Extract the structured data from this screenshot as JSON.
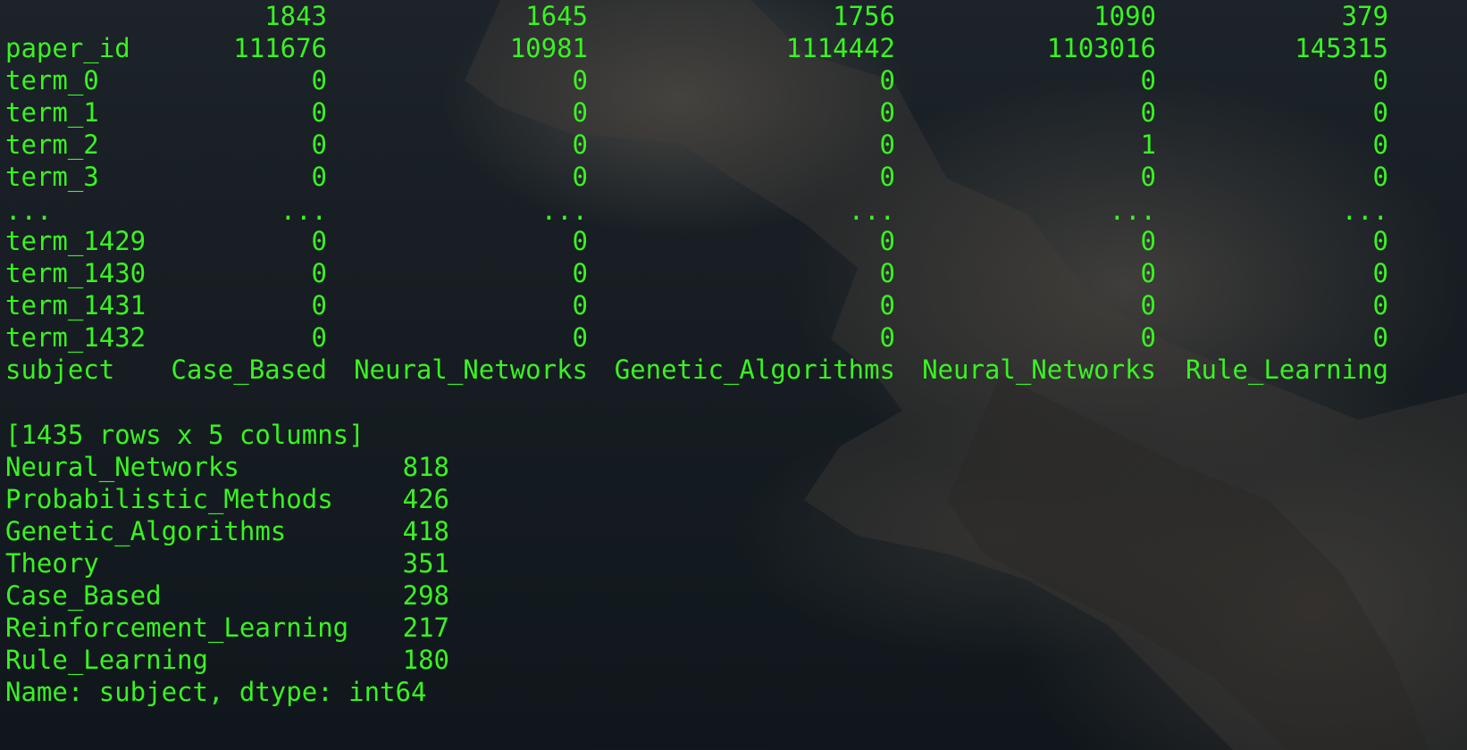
{
  "terminal": {
    "text_color": "#39f321",
    "dataframe": {
      "header_index": [
        "1843",
        "1645",
        "1756",
        "1090",
        "379"
      ],
      "rows": [
        {
          "label": "paper_id",
          "cells": [
            "111676",
            "10981",
            "1114442",
            "1103016",
            "145315"
          ]
        },
        {
          "label": "term_0",
          "cells": [
            "0",
            "0",
            "0",
            "0",
            "0"
          ]
        },
        {
          "label": "term_1",
          "cells": [
            "0",
            "0",
            "0",
            "0",
            "0"
          ]
        },
        {
          "label": "term_2",
          "cells": [
            "0",
            "0",
            "0",
            "1",
            "0"
          ]
        },
        {
          "label": "term_3",
          "cells": [
            "0",
            "0",
            "0",
            "0",
            "0"
          ]
        },
        {
          "label": "...",
          "cells": [
            "...",
            "...",
            "...",
            "...",
            "..."
          ]
        },
        {
          "label": "term_1429",
          "cells": [
            "0",
            "0",
            "0",
            "0",
            "0"
          ]
        },
        {
          "label": "term_1430",
          "cells": [
            "0",
            "0",
            "0",
            "0",
            "0"
          ]
        },
        {
          "label": "term_1431",
          "cells": [
            "0",
            "0",
            "0",
            "0",
            "0"
          ]
        },
        {
          "label": "term_1432",
          "cells": [
            "0",
            "0",
            "0",
            "0",
            "0"
          ]
        },
        {
          "label": "subject",
          "cells": [
            "Case_Based",
            "Neural_Networks",
            "Genetic_Algorithms",
            "Neural_Networks",
            "Rule_Learning"
          ]
        }
      ],
      "shape": "[1435 rows x 5 columns]"
    },
    "value_counts": {
      "items": [
        {
          "label": "Neural_Networks",
          "count": "818"
        },
        {
          "label": "Probabilistic_Methods",
          "count": "426"
        },
        {
          "label": "Genetic_Algorithms",
          "count": "418"
        },
        {
          "label": "Theory",
          "count": "351"
        },
        {
          "label": "Case_Based",
          "count": "298"
        },
        {
          "label": "Reinforcement_Learning",
          "count": "217"
        },
        {
          "label": "Rule_Learning",
          "count": "180"
        }
      ],
      "footer": "Name: subject, dtype: int64"
    }
  }
}
